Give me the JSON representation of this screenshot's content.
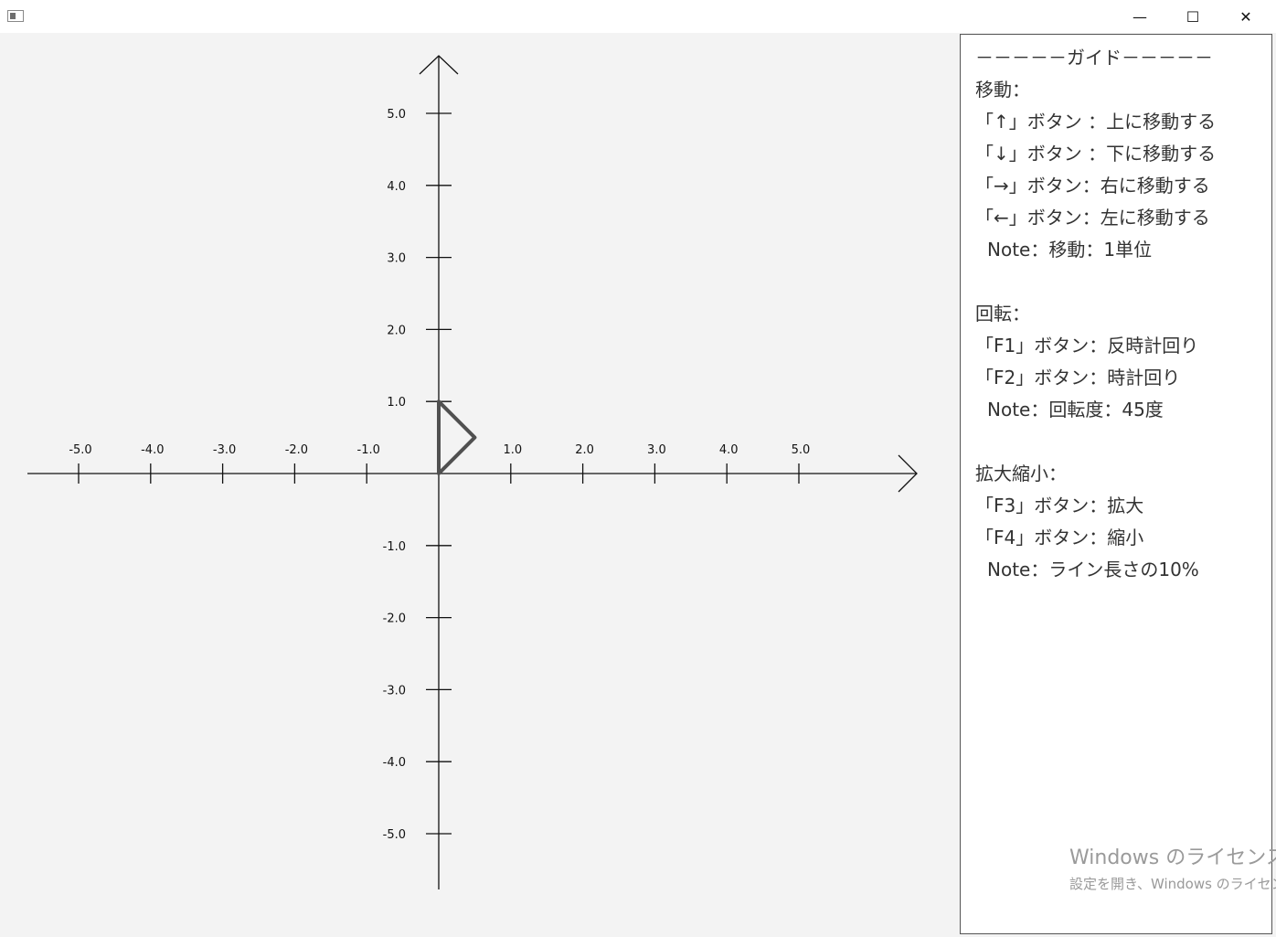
{
  "window": {
    "minimize_glyph": "—",
    "maximize_glyph": "☐",
    "close_glyph": "✕"
  },
  "chart_data": {
    "type": "line",
    "xlim": [
      -5.0,
      5.0
    ],
    "ylim": [
      -5.0,
      5.0
    ],
    "x_ticks": [
      "-5.0",
      "-4.0",
      "-3.0",
      "-2.0",
      "-1.0",
      "1.0",
      "2.0",
      "3.0",
      "4.0",
      "5.0"
    ],
    "y_ticks": [
      "5.0",
      "4.0",
      "3.0",
      "2.0",
      "1.0",
      "-1.0",
      "-2.0",
      "-3.0",
      "-4.0",
      "-5.0"
    ],
    "shape": {
      "name": "triangle",
      "points": [
        [
          0,
          0
        ],
        [
          0,
          1.0
        ],
        [
          0.5,
          0.5
        ]
      ],
      "color": "#505050"
    },
    "axis_color": "#111111"
  },
  "guide": {
    "lines": [
      "－－－－－ガイド－－－－－",
      "移動：",
      "「↑」ボタン ：上に移動する",
      "「↓」ボタン ：下に移動する",
      "「→」ボタン：右に移動する",
      "「←」ボタン：左に移動する",
      "Note：移動：1単位",
      "",
      "回転：",
      "「F1」ボタン：反時計回り",
      "「F2」ボタン：時計回り",
      "Note：回転度：45度",
      "",
      "拡大縮小：",
      "「F3」ボタン：拡大",
      "「F4」ボタン：縮小",
      "Note：ライン長さの10%"
    ]
  },
  "watermark": {
    "line1": "Windows のライセンス認証",
    "line2": "設定を開き、Windows のライセンス認証を行ってください。"
  }
}
